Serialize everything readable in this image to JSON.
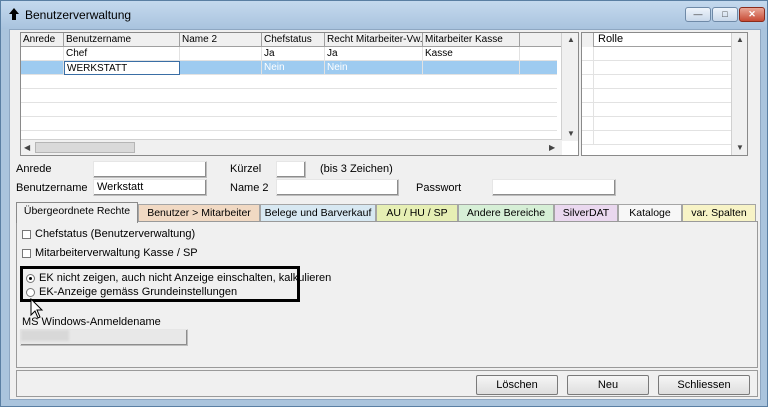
{
  "window": {
    "title": "Benutzerverwaltung",
    "min": "—",
    "max": "□",
    "close": "✕"
  },
  "grid": {
    "headers": [
      "Anrede",
      "Benutzername",
      "Name 2",
      "Chefstatus",
      "Recht Mitarbeiter-Vw.",
      "Mitarbeiter Kasse"
    ],
    "rows": [
      [
        "",
        "Chef",
        "",
        "Ja",
        "Ja",
        "Kasse"
      ],
      [
        "",
        "WERKSTATT",
        "",
        "Nein",
        "Nein",
        ""
      ]
    ]
  },
  "role_grid": {
    "header": "Rolle"
  },
  "form": {
    "anrede_label": "Anrede",
    "anrede_value": "",
    "kuerzel_label": "Kürzel",
    "kuerzel_value": "",
    "kuerzel_hint": "(bis 3 Zeichen)",
    "benutzername_label": "Benutzername",
    "benutzername_value": "Werkstatt",
    "name2_label": "Name 2",
    "name2_value": "",
    "passwort_label": "Passwort",
    "passwort_value": ""
  },
  "tabs": [
    {
      "label": "Übergeordnete Rechte",
      "color": "#f0f0f0"
    },
    {
      "label": "Benutzer > Mitarbeiter",
      "color": "#f1d9c3"
    },
    {
      "label": "Belege und Barverkauf",
      "color": "#d7e8f2"
    },
    {
      "label": "AU / HU / SP",
      "color": "#e6efb4"
    },
    {
      "label": "Andere Bereiche",
      "color": "#d6efd6"
    },
    {
      "label": "SilverDAT",
      "color": "#ead8ef"
    },
    {
      "label": "Kataloge",
      "color": "#f7f7f7"
    },
    {
      "label": "var. Spalten",
      "color": "#f7f3c6"
    }
  ],
  "panel": {
    "chk_chefstatus": "Chefstatus (Benutzerverwaltung)",
    "chk_mitarbeiterverwaltung": "Mitarbeiterverwaltung Kasse / SP",
    "radio_ek_nicht": "EK nicht zeigen, auch nicht Anzeige einschalten, kalkulieren",
    "radio_ek_anzeige": "EK-Anzeige gemäss Grundeinstellungen",
    "windows_label": "MS Windows-Anmeldename",
    "windows_value": ""
  },
  "buttons": {
    "loeschen": "Löschen",
    "neu": "Neu",
    "schliessen": "Schliessen"
  }
}
